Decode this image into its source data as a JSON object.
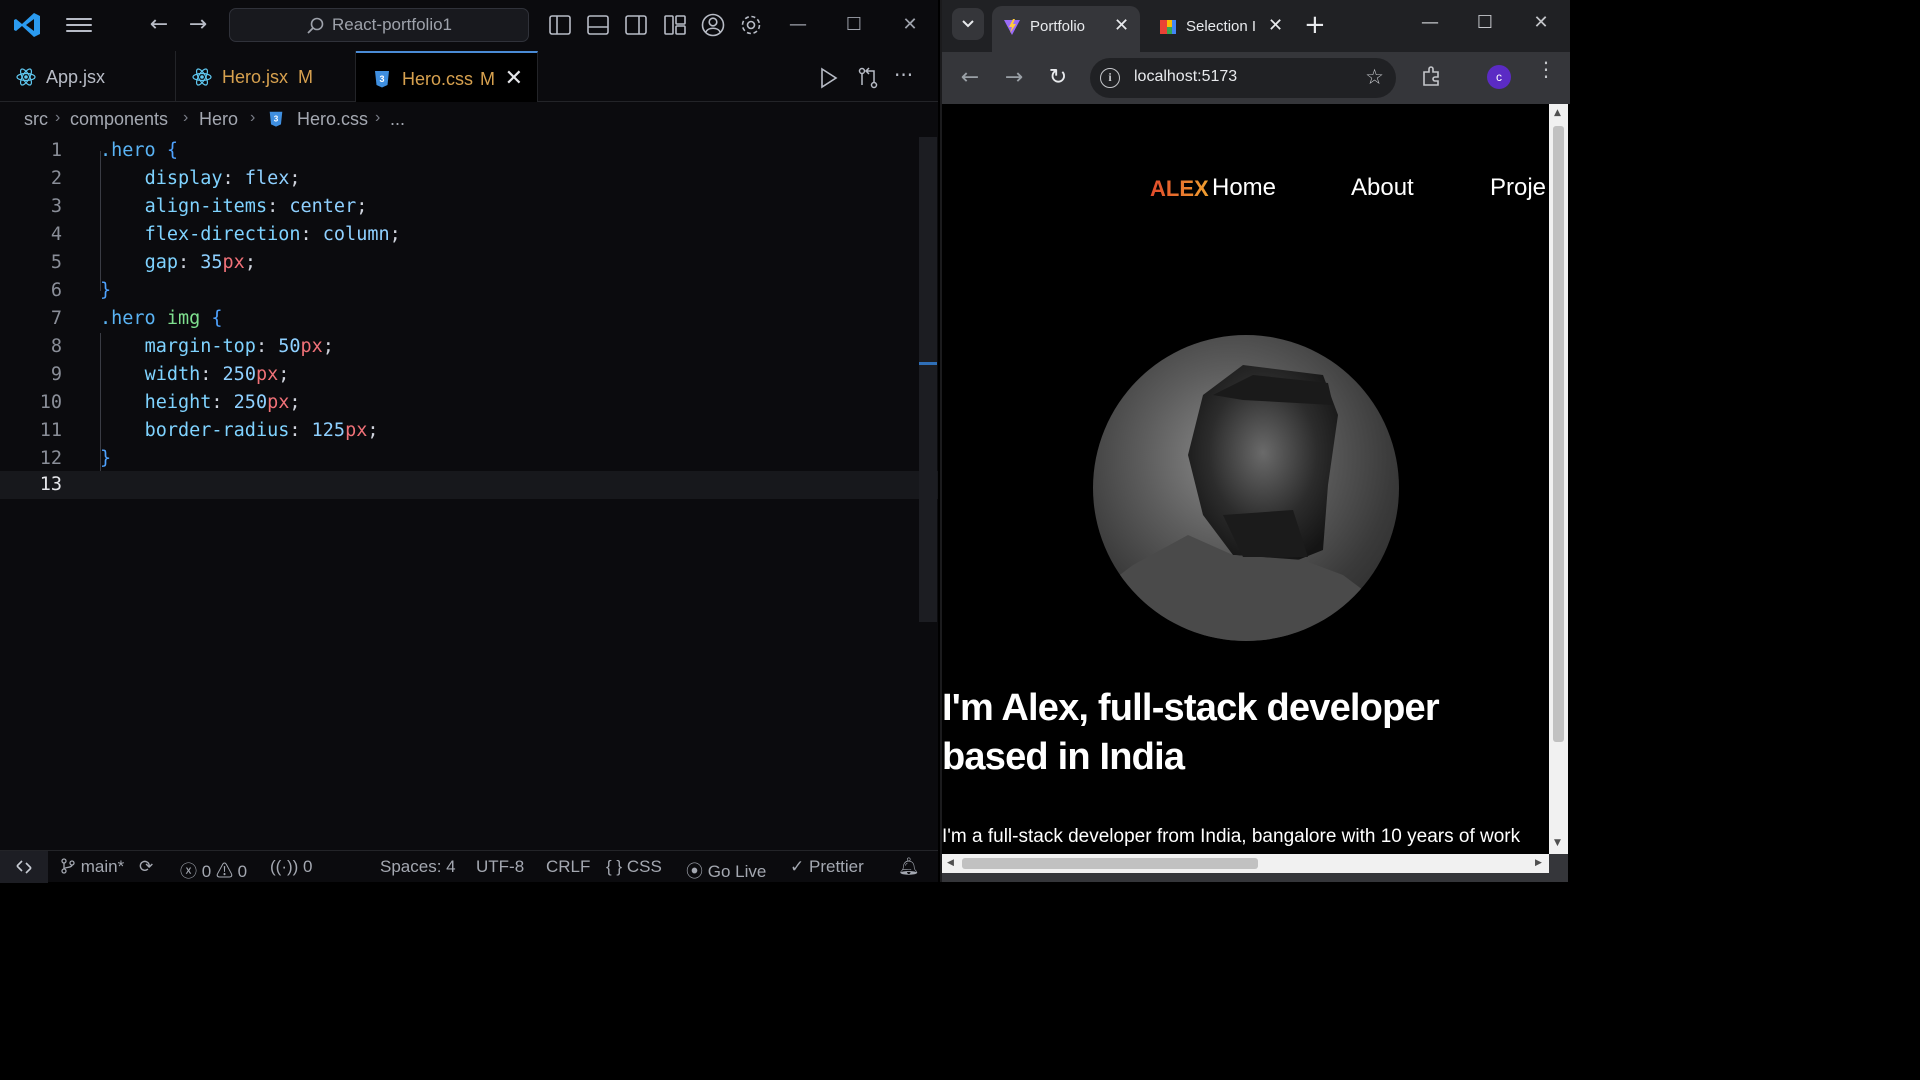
{
  "vscode": {
    "search_text": "React-portfolio1",
    "tabs": [
      {
        "label": "App.jsx",
        "modified": ""
      },
      {
        "label": "Hero.jsx",
        "modified": "M"
      },
      {
        "label": "Hero.css",
        "modified": "M"
      }
    ],
    "breadcrumb": [
      "src",
      "components",
      "Hero",
      "Hero.css",
      "..."
    ],
    "code_lines": [
      {
        "n": "1"
      },
      {
        "n": "2"
      },
      {
        "n": "3"
      },
      {
        "n": "4"
      },
      {
        "n": "5"
      },
      {
        "n": "6"
      },
      {
        "n": "7"
      },
      {
        "n": "8"
      },
      {
        "n": "9"
      },
      {
        "n": "10"
      },
      {
        "n": "11"
      },
      {
        "n": "12"
      },
      {
        "n": "13"
      }
    ],
    "code": {
      "l1_sel": ".hero",
      "l1_brace": "{",
      "l2_prop": "display",
      "l2_val": "flex",
      "l3_prop": "align-items",
      "l3_val": "center",
      "l4_prop": "flex-direction",
      "l4_val": "column",
      "l5_prop": "gap",
      "l5_num": "35",
      "l5_unit": "px",
      "l6_brace": "}",
      "l7_sel": ".hero",
      "l7_tag": "img",
      "l7_brace": "{",
      "l8_prop": "margin-top",
      "l8_num": "50",
      "l8_unit": "px",
      "l9_prop": "width",
      "l9_num": "250",
      "l9_unit": "px",
      "l10_prop": "height",
      "l10_num": "250",
      "l10_unit": "px",
      "l11_prop": "border-radius",
      "l11_num": "125",
      "l11_unit": "px",
      "l12_brace": "}"
    },
    "status": {
      "branch": "main*",
      "errors": "0",
      "warnings": "0",
      "ports": "0",
      "spaces": "Spaces: 4",
      "encoding": "UTF-8",
      "eol": "CRLF",
      "language": "CSS",
      "golive": "Go Live",
      "prettier": "Prettier"
    }
  },
  "browser": {
    "tabs": [
      {
        "title": "Portfolio"
      },
      {
        "title": "Selection I"
      }
    ],
    "url": "localhost:5173",
    "profile_initial": "c",
    "site": {
      "logo": "ALEX",
      "nav": [
        "Home",
        "About",
        "Proje"
      ],
      "hero_title": "I'm Alex, full-stack developer based in India",
      "hero_sub": "I'm a full-stack developer from India, bangalore with 10 years of work"
    }
  }
}
